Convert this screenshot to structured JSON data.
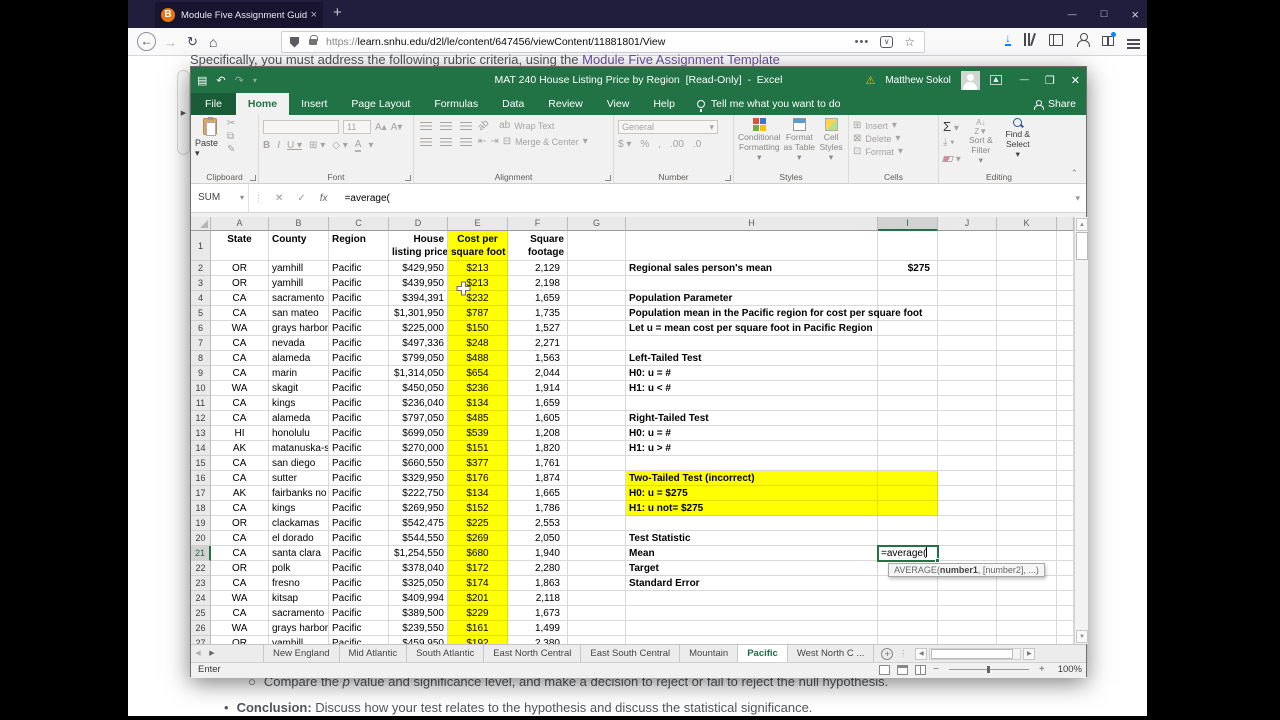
{
  "colors": {
    "excel_green": "#217346",
    "highlight_yellow": "#ffff00",
    "firefox_accent": "#0a84ff",
    "link_purple": "#6a51a3",
    "warning_orange": "#ffb900"
  },
  "browser": {
    "tab_title": "Module Five Assignment Guid",
    "tab_close": "×",
    "new_tab_label": "+",
    "url_protocol": "https://",
    "url_rest": "learn.snhu.edu/d2l/le/content/647456/viewContent/11881801/View",
    "win_minimize": "—",
    "win_maximize": "□",
    "win_close": "×",
    "page": {
      "line1": "Specifically, you must address the following rubric criteria, using the ",
      "line1_link": "Module Five Assignment Template",
      "bullet1_mark": "○",
      "bullet1_pre": "Compare the ",
      "bullet1_italic": "p",
      "bullet1_post": " value and significance level, and make a decision to reject or fail to reject the null hypothesis.",
      "bullet2_mark": "•",
      "bullet2_bold": "Conclusion:",
      "bullet2_rest": " Discuss how your test relates to the hypothesis and discuss the statistical significance."
    }
  },
  "excel": {
    "titlebar": {
      "title": "MAT 240 House Listing Price by Region  [Read-Only]  -  Excel",
      "user_name": "Matthew Sokol",
      "minimize": "—",
      "maximize": "❐",
      "close": "✕"
    },
    "ribbon": {
      "tabs": [
        "File",
        "Home",
        "Insert",
        "Page Layout",
        "Formulas",
        "Data",
        "Review",
        "View",
        "Help"
      ],
      "active_tab": "Home",
      "tell_me": "Tell me what you want to do",
      "share": "Share",
      "groups": {
        "clipboard": {
          "label": "Clipboard",
          "paste": "Paste"
        },
        "font": {
          "label": "Font",
          "size": "11"
        },
        "alignment": {
          "label": "Alignment",
          "wrap": "Wrap Text",
          "merge": "Merge & Center"
        },
        "number": {
          "label": "Number",
          "format": "General"
        },
        "styles": {
          "label": "Styles",
          "cf": "Conditional Formatting",
          "fat": "Format as Table",
          "cs": "Cell Styles"
        },
        "cells": {
          "label": "Cells",
          "insert": "Insert",
          "delete": "Delete",
          "format": "Format"
        },
        "editing": {
          "label": "Editing",
          "sort": "Sort & Filter",
          "find": "Find & Select"
        }
      }
    },
    "formula_bar": {
      "name_box": "SUM",
      "formula": "=average("
    },
    "sheet": {
      "columns": [
        "A",
        "B",
        "C",
        "D",
        "E",
        "F",
        "G",
        "H",
        "I",
        "J",
        "K"
      ],
      "header_cells": {
        "A": [
          "State"
        ],
        "B": [
          "County"
        ],
        "C": [
          "Region"
        ],
        "D": [
          "House",
          "listing price"
        ],
        "E": [
          "Cost per",
          "square foot"
        ],
        "F": [
          "Square",
          "footage"
        ]
      },
      "rows": [
        [
          "OR",
          "yamhill",
          "Pacific",
          "$429,950",
          "$213",
          "2,129"
        ],
        [
          "OR",
          "yamhill",
          "Pacific",
          "$439,950",
          "$213",
          "2,198"
        ],
        [
          "CA",
          "sacramento",
          "Pacific",
          "$394,391",
          "$232",
          "1,659"
        ],
        [
          "CA",
          "san mateo",
          "Pacific",
          "$1,301,950",
          "$787",
          "1,735"
        ],
        [
          "WA",
          "grays harbor",
          "Pacific",
          "$225,000",
          "$150",
          "1,527"
        ],
        [
          "CA",
          "nevada",
          "Pacific",
          "$497,336",
          "$248",
          "2,271"
        ],
        [
          "CA",
          "alameda",
          "Pacific",
          "$799,050",
          "$488",
          "1,563"
        ],
        [
          "CA",
          "marin",
          "Pacific",
          "$1,314,050",
          "$654",
          "2,044"
        ],
        [
          "WA",
          "skagit",
          "Pacific",
          "$450,050",
          "$236",
          "1,914"
        ],
        [
          "CA",
          "kings",
          "Pacific",
          "$236,040",
          "$134",
          "1,659"
        ],
        [
          "CA",
          "alameda",
          "Pacific",
          "$797,050",
          "$485",
          "1,605"
        ],
        [
          "HI",
          "honolulu",
          "Pacific",
          "$699,050",
          "$539",
          "1,208"
        ],
        [
          "AK",
          "matanuska-s",
          "Pacific",
          "$270,000",
          "$151",
          "1,820"
        ],
        [
          "CA",
          "san diego",
          "Pacific",
          "$660,550",
          "$377",
          "1,761"
        ],
        [
          "CA",
          "sutter",
          "Pacific",
          "$329,950",
          "$176",
          "1,874"
        ],
        [
          "AK",
          "fairbanks no",
          "Pacific",
          "$222,750",
          "$134",
          "1,665"
        ],
        [
          "CA",
          "kings",
          "Pacific",
          "$269,950",
          "$152",
          "1,786"
        ],
        [
          "OR",
          "clackamas",
          "Pacific",
          "$542,475",
          "$225",
          "2,553"
        ],
        [
          "CA",
          "el dorado",
          "Pacific",
          "$544,550",
          "$269",
          "2,050"
        ],
        [
          "CA",
          "santa clara",
          "Pacific",
          "$1,254,550",
          "$680",
          "1,940"
        ],
        [
          "OR",
          "polk",
          "Pacific",
          "$378,040",
          "$172",
          "2,280"
        ],
        [
          "CA",
          "fresno",
          "Pacific",
          "$325,050",
          "$174",
          "1,863"
        ],
        [
          "WA",
          "kitsap",
          "Pacific",
          "$409,994",
          "$201",
          "2,118"
        ],
        [
          "CA",
          "sacramento",
          "Pacific",
          "$389,500",
          "$229",
          "1,673"
        ],
        [
          "WA",
          "grays harbor",
          "Pacific",
          "$239,550",
          "$161",
          "1,499"
        ],
        [
          "OR",
          "yamhill",
          "Pacific",
          "$459,950",
          "$192",
          "2,380"
        ]
      ],
      "notes": {
        "2": {
          "h": "Regional sales person's mean",
          "i": "$275"
        },
        "4": {
          "h": "Population Parameter"
        },
        "5": {
          "h": "Population mean in the Pacific region for cost per square foot"
        },
        "6": {
          "h": "Let u = mean cost per square foot in Pacific Region"
        },
        "8": {
          "h": "Left-Tailed Test"
        },
        "9": {
          "h": "H0: u = #"
        },
        "10": {
          "h": "H1: u < #"
        },
        "12": {
          "h": "Right-Tailed Test"
        },
        "13": {
          "h": "H0: u = #"
        },
        "14": {
          "h": "H1: u > #"
        },
        "16": {
          "h": "Two-Tailed Test (incorrect)",
          "yellow": true
        },
        "17": {
          "h": "H0: u = $275",
          "yellow": true
        },
        "18": {
          "h": "H1: u not= $275",
          "yellow": true
        },
        "20": {
          "h": "Test Statistic"
        },
        "21": {
          "h": "Mean"
        },
        "22": {
          "h": "Target"
        },
        "23": {
          "h": "Standard Error"
        }
      },
      "active_cell": {
        "ref": "I21",
        "col": "I",
        "row": 21,
        "formula": "=average(",
        "tooltip_pre": "AVERAGE(",
        "tooltip_bold": "number1",
        "tooltip_post": ", [number2], ...)"
      }
    },
    "sheet_tabs": {
      "tabs": [
        "New England",
        "Mid Atlantic",
        "South Atlantic",
        "East North Central",
        "East South Central",
        "Mountain",
        "Pacific",
        "West North C ..."
      ],
      "active": "Pacific",
      "add_label": "+"
    },
    "status_bar": {
      "mode": "Enter",
      "zoom_level": "100%"
    }
  }
}
